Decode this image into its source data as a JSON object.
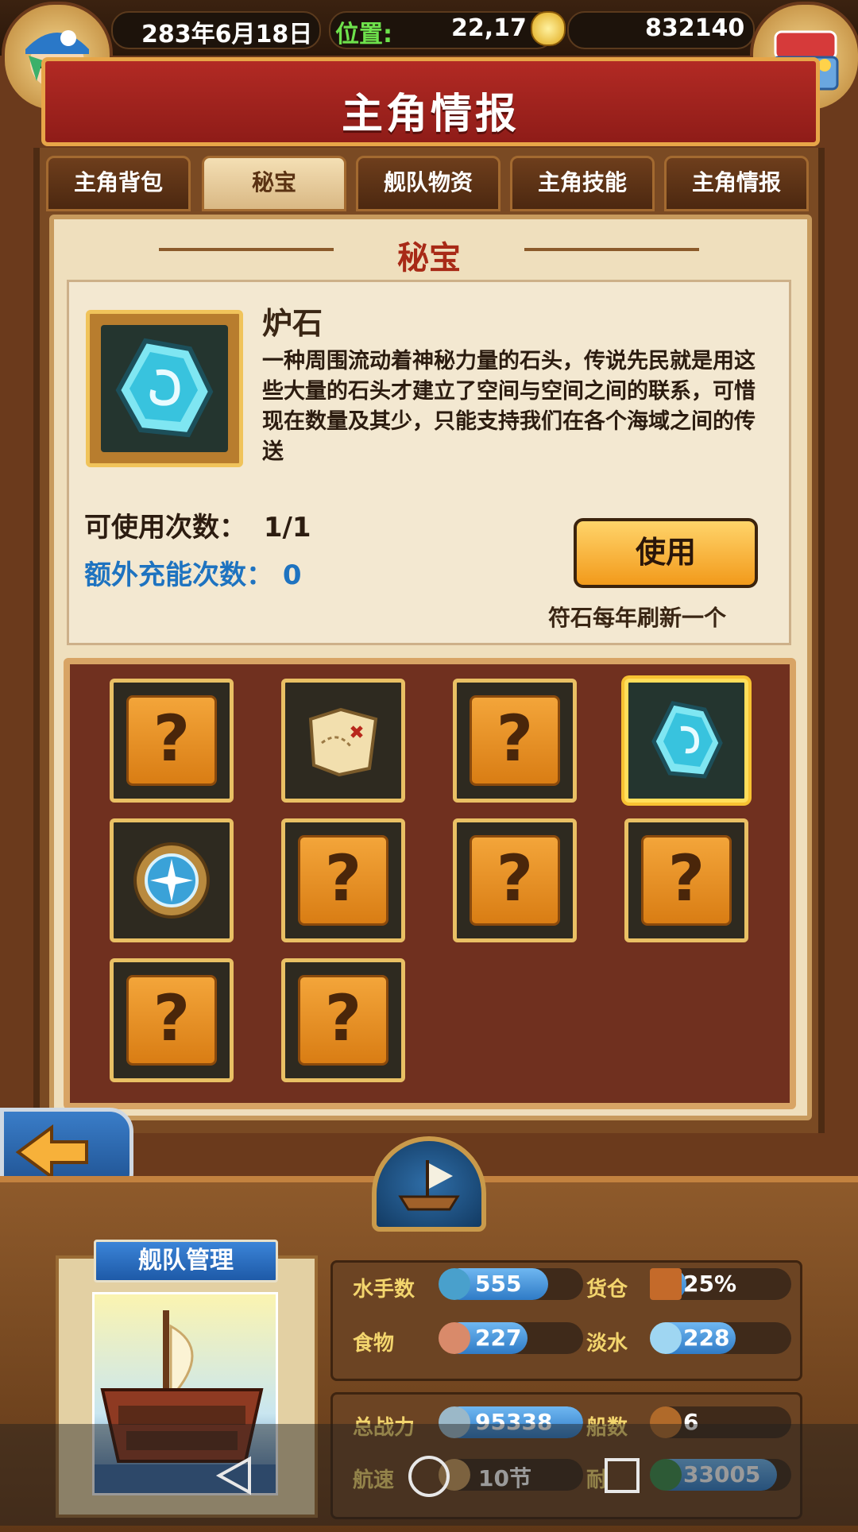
{
  "topbar": {
    "date": "283年6月18日",
    "position_label": "位置:",
    "position_value": "22,17",
    "gold": "832140"
  },
  "title": "主角情报",
  "tabs": [
    {
      "label": "主角背包",
      "active": false
    },
    {
      "label": "秘宝",
      "active": true
    },
    {
      "label": "舰队物资",
      "active": false
    },
    {
      "label": "主角技能",
      "active": false
    },
    {
      "label": "主角情报",
      "active": false
    }
  ],
  "section_title": "秘宝",
  "selected_item": {
    "name": "炉石",
    "description": "一种周围流动着神秘力量的石头，传说先民就是用这些大量的石头才建立了空间与空间之间的联系，可惜现在数量及其少，只能支持我们在各个海域之间的传送",
    "uses_label": "可使用次数：",
    "uses_value": "1/1",
    "extra_label": "额外充能次数：",
    "extra_value": "0",
    "use_button": "使用",
    "refresh_note": "符石每年刷新一个",
    "icon": "hearthstone-icon"
  },
  "grid": [
    {
      "icon": "unknown-icon",
      "text": "?"
    },
    {
      "icon": "treasure-map-icon",
      "text": ""
    },
    {
      "icon": "unknown-icon",
      "text": "?"
    },
    {
      "icon": "hearthstone-icon",
      "text": "",
      "selected": true
    },
    {
      "icon": "compass-shield-icon",
      "text": ""
    },
    {
      "icon": "unknown-icon",
      "text": "?"
    },
    {
      "icon": "unknown-icon",
      "text": "?"
    },
    {
      "icon": "unknown-icon",
      "text": "?"
    },
    {
      "icon": "unknown-icon",
      "text": "?"
    },
    {
      "icon": "unknown-icon",
      "text": "?"
    }
  ],
  "fleet": {
    "banner": "舰队管理",
    "stats": [
      {
        "label": "水手数",
        "value": "555",
        "icon": "sailor-icon",
        "fill": 0.75
      },
      {
        "label": "货仓",
        "value": "25%",
        "icon": "crate-icon",
        "fill": 0.25
      },
      {
        "label": "食物",
        "value": "227",
        "icon": "meat-icon",
        "fill": 0.6
      },
      {
        "label": "淡水",
        "value": "228",
        "icon": "water-jug-icon",
        "fill": 0.6
      },
      {
        "label": "总战力",
        "value": "95338",
        "icon": "crossed-swords-icon",
        "fill": 1.0
      },
      {
        "label": "船数",
        "value": "6",
        "icon": "ship-icon",
        "fill": 0.0
      },
      {
        "label": "航速",
        "value": "10节",
        "icon": "sail-icon",
        "fill": 0.0
      },
      {
        "label": "耐",
        "value": "33005",
        "icon": "anchor-icon",
        "fill": 0.9
      }
    ]
  },
  "colors": {
    "title_red": "#a82a17",
    "accent_blue": "#1e73c0",
    "gold": "#f0c35a"
  }
}
